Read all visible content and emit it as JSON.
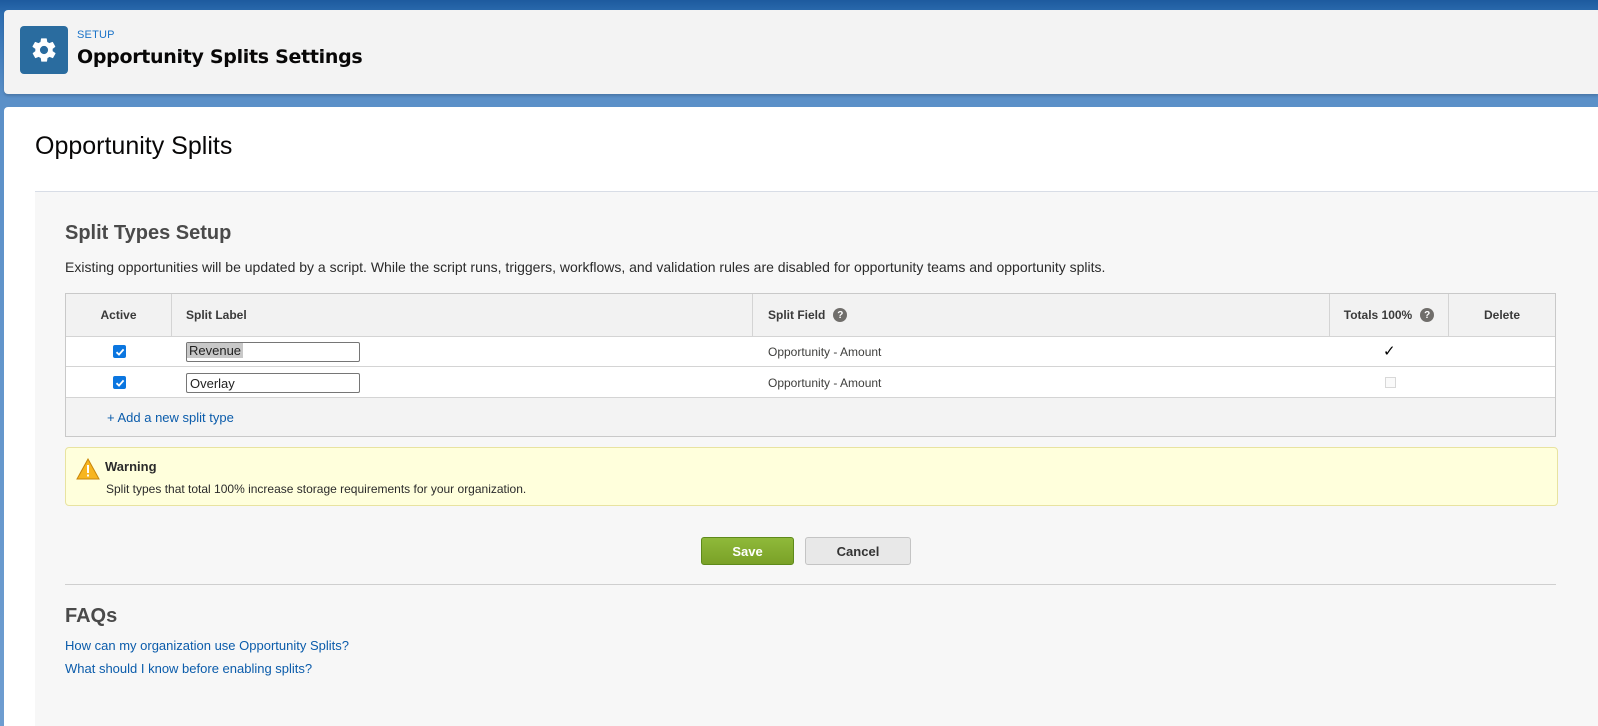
{
  "header": {
    "eyebrow": "SETUP",
    "title": "Opportunity Splits Settings",
    "icon": "gear-icon",
    "icon_color": "#2a6c9f"
  },
  "page": {
    "title": "Opportunity Splits"
  },
  "split_types": {
    "title": "Split Types Setup",
    "description": "Existing opportunities will be updated by a script. While the script runs, triggers, workflows, and validation rules are disabled for opportunity teams and opportunity splits.",
    "columns": {
      "active": "Active",
      "split_label": "Split Label",
      "split_field": "Split Field",
      "totals": "Totals 100%",
      "delete": "Delete"
    },
    "rows": [
      {
        "active": true,
        "label": "Revenue",
        "field": "Opportunity - Amount",
        "totals_100": true
      },
      {
        "active": true,
        "label": "Overlay",
        "field": "Opportunity - Amount",
        "totals_100": false
      }
    ],
    "add_link": "+ Add a new split type"
  },
  "warning": {
    "title": "Warning",
    "text": "Split types that total 100% increase storage requirements for your organization."
  },
  "actions": {
    "save": "Save",
    "cancel": "Cancel"
  },
  "faqs": {
    "title": "FAQs",
    "links": [
      "How can my organization use Opportunity Splits?",
      "What should I know before enabling splits?"
    ]
  },
  "colors": {
    "save_button": "#85ad2d",
    "link": "#0b5cab",
    "warning_bg": "#ffffdc",
    "checkbox": "#0b76e0"
  }
}
